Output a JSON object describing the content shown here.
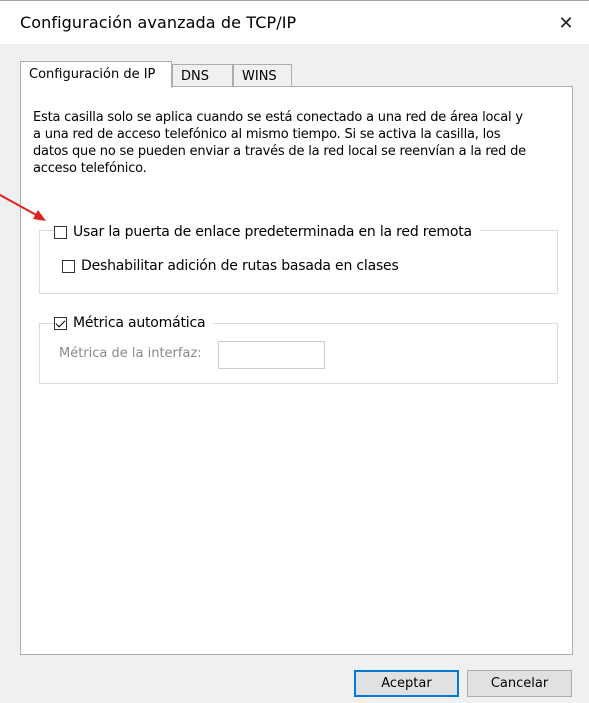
{
  "window": {
    "title": "Configuración avanzada de TCP/IP",
    "close_glyph": "✕"
  },
  "tabs": [
    {
      "label": "Configuración de IP",
      "active": true
    },
    {
      "label": "DNS",
      "active": false
    },
    {
      "label": "WINS",
      "active": false
    }
  ],
  "ip_tab": {
    "description": "Esta casilla solo se aplica cuando se está conectado a una red de área local y a una red de acceso telefónico al mismo tiempo. Si se activa la casilla, los datos que no se pueden enviar a través de la red local se reenvían a la red de acceso telefónico.",
    "use_default_gateway": {
      "label": "Usar la puerta de enlace predeterminada en la red remota",
      "checked": false
    },
    "disable_class_routes": {
      "label": "Deshabilitar adición de rutas basada en clases",
      "checked": false
    },
    "automatic_metric": {
      "label": "Métrica automática",
      "checked": true
    },
    "interface_metric": {
      "label": "Métrica de la interfaz:",
      "value": ""
    }
  },
  "buttons": {
    "ok": "Aceptar",
    "cancel": "Cancelar"
  },
  "annotation": {
    "arrow_color": "#e02020"
  }
}
